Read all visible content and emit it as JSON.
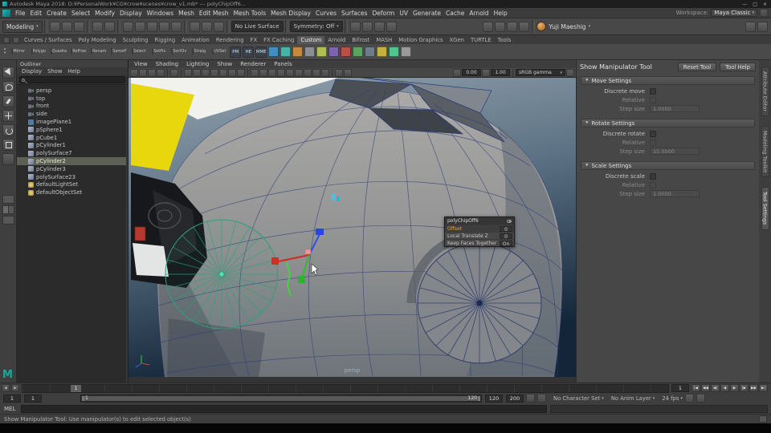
{
  "title_bar": {
    "app_title": "Autodesk Maya 2018: D:¥PersonalWork¥CG¥crow¥scenes¥crow_v1.mb* --- polyChipOff6...",
    "window_controls": {
      "minimize": "—",
      "maximize": "□",
      "close": "×"
    }
  },
  "menu_bar": {
    "items": [
      "File",
      "Edit",
      "Create",
      "Select",
      "Modify",
      "Display",
      "Windows",
      "Mesh",
      "Edit Mesh",
      "Mesh Tools",
      "Mesh Display",
      "Curves",
      "Surfaces",
      "Deform",
      "UV",
      "Generate",
      "Cache",
      "Arnold",
      "Help"
    ],
    "workspace_label": "Workspace:",
    "workspace_value": "Maya Classic"
  },
  "status_line": {
    "mode_selector": "Modeling",
    "live_surface": "No Live Surface",
    "symmetry": "Symmetry: Off",
    "user_name": "Yuji Maeshig"
  },
  "shelf": {
    "tabs": [
      {
        "label": "Curves / Surfaces"
      },
      {
        "label": "Poly Modeling"
      },
      {
        "label": "Sculpting"
      },
      {
        "label": "Rigging"
      },
      {
        "label": "Animation"
      },
      {
        "label": "Rendering"
      },
      {
        "label": "FX"
      },
      {
        "label": "FX Caching"
      },
      {
        "label": "Custom",
        "active": true
      },
      {
        "label": "Arnold"
      },
      {
        "label": "Bifrost"
      },
      {
        "label": "MASH"
      },
      {
        "label": "Motion Graphics"
      },
      {
        "label": "XGen"
      },
      {
        "label": "TURTLE"
      },
      {
        "label": "Tools"
      }
    ],
    "labeled_items": [
      "Mirror",
      "Polygo",
      "Quadra",
      "ReFree",
      "Renam",
      "SameP",
      "Select",
      "SetPiv",
      "SortOv",
      "Straig",
      "UVSet"
    ],
    "text_icons": [
      "PM",
      "HE",
      "MME"
    ]
  },
  "outliner": {
    "title": "Outliner",
    "menus": [
      "Display",
      "Show",
      "Help"
    ],
    "items": [
      {
        "label": "persp",
        "type": "camera"
      },
      {
        "label": "top",
        "type": "camera"
      },
      {
        "label": "front",
        "type": "camera"
      },
      {
        "label": "side",
        "type": "camera"
      },
      {
        "label": "imagePlane1",
        "type": "imageplane"
      },
      {
        "label": "pSphere1",
        "type": "mesh"
      },
      {
        "label": "pCube1",
        "type": "mesh"
      },
      {
        "label": "pCylinder1",
        "type": "mesh"
      },
      {
        "label": "polySurface7",
        "type": "mesh"
      },
      {
        "label": "pCylinder2",
        "type": "mesh",
        "selected": true
      },
      {
        "label": "pCylinder3",
        "type": "mesh"
      },
      {
        "label": "polySurface23",
        "type": "mesh"
      },
      {
        "label": "defaultLightSet",
        "type": "set"
      },
      {
        "label": "defaultObjectSet",
        "type": "set"
      }
    ]
  },
  "viewport": {
    "menus": [
      "View",
      "Shading",
      "Lighting",
      "Show",
      "Renderer",
      "Panels"
    ],
    "exposure": "0.00",
    "gamma": "1.00",
    "view_transform": "sRGB gamma",
    "camera_label": "persp",
    "hud": {
      "title": "polyChipOff6",
      "rows": [
        {
          "label": "Offset",
          "value": "0",
          "highlight": true
        },
        {
          "label": "Local Translate Z",
          "value": "0"
        },
        {
          "label": "Keep Faces Together",
          "value": "On"
        }
      ]
    }
  },
  "tool_settings": {
    "title": "Show Manipulator Tool",
    "reset_button": "Reset Tool",
    "help_button": "Tool Help",
    "sections": [
      {
        "title": "Move Settings",
        "rows": [
          {
            "label": "Discrete move",
            "control": "checkbox"
          },
          {
            "label": "Relative",
            "control": "checkbox",
            "disabled": true
          },
          {
            "label": "Step size",
            "control": "field",
            "value": "1.0000",
            "disabled": true
          }
        ]
      },
      {
        "title": "Rotate Settings",
        "rows": [
          {
            "label": "Discrete rotate",
            "control": "checkbox"
          },
          {
            "label": "Relative",
            "control": "checkbox",
            "disabled": true
          },
          {
            "label": "Step size",
            "control": "field",
            "value": "15.0000",
            "disabled": true
          }
        ]
      },
      {
        "title": "Scale Settings",
        "rows": [
          {
            "label": "Discrete scale",
            "control": "checkbox"
          },
          {
            "label": "Relative",
            "control": "checkbox",
            "disabled": true
          },
          {
            "label": "Step size",
            "control": "field",
            "value": "1.0000",
            "disabled": true
          }
        ]
      }
    ]
  },
  "right_tabs": [
    {
      "label": "Attribute Editor"
    },
    {
      "label": "Modeling Toolkit"
    },
    {
      "label": "Tool Settings",
      "active": true
    }
  ],
  "time_slider": {
    "current_frame": "1",
    "frame_field": "1"
  },
  "range_slider": {
    "anim_start": "1",
    "playback_start": "1",
    "bar_start": "1",
    "bar_end": "120",
    "playback_end": "120",
    "anim_end": "200",
    "character_set": "No Character Set",
    "anim_layer": "No Anim Layer",
    "fps": "24 fps"
  },
  "command_line": {
    "label": "MEL"
  },
  "help_line": {
    "text": "Show Manipulator Tool: Use manipulator(s) to edit selected object(s)"
  },
  "icons": {
    "chevron_down": "▾",
    "shelf_up": "▴",
    "shelf_down": "▾",
    "timeline_prev": "◀",
    "timeline_next": "▶",
    "transport": [
      "|◀",
      "◀◀",
      "◀|",
      "◀",
      "▶",
      "|▶",
      "▶▶",
      "▶|"
    ]
  }
}
